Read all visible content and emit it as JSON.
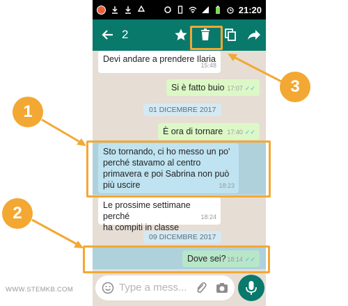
{
  "status_bar": {
    "time": "21:20",
    "icons": [
      "notification-badge",
      "download-icon",
      "download-icon",
      "recycle-icon",
      "sync-icon",
      "vibrate-icon",
      "wifi-icon",
      "signal-icon",
      "battery-icon",
      "alarm-icon"
    ]
  },
  "action_bar": {
    "selected_count": "2",
    "icons": [
      "back-arrow-icon",
      "star-icon",
      "delete-icon",
      "copy-icon",
      "forward-icon"
    ]
  },
  "messages": [
    {
      "text": "Devi andare a prendere Ilaria",
      "time": "15:48",
      "direction": "in"
    },
    {
      "text": "Si è fatto buio",
      "time": "17:07",
      "direction": "out"
    },
    {
      "date": "01 DICEMBRE 2017"
    },
    {
      "text": "È ora di tornare",
      "time": "17:40",
      "direction": "out"
    },
    {
      "lines": [
        "Sto tornando, ci ho messo un po'",
        "perché stavamo al centro",
        "primavera e poi Sabrina non può",
        "più uscire"
      ],
      "time": "18:23",
      "direction": "in",
      "selected": true
    },
    {
      "lines": [
        "Le prossime settimane perché",
        "ha compiti in classe"
      ],
      "time": "18:24",
      "direction": "in"
    },
    {
      "date": "09 DICEMBRE 2017"
    },
    {
      "text": "Dove sei?",
      "time": "18:14",
      "direction": "out",
      "selected": true
    }
  ],
  "input_bar": {
    "placeholder": "Type a mess...",
    "icons": [
      "emoji-icon",
      "attach-icon",
      "camera-icon",
      "mic-icon"
    ]
  },
  "annotations": {
    "labels": [
      "1",
      "2",
      "3"
    ],
    "color": "#f3a833"
  },
  "watermark": "WWW.STEMKB.COM",
  "colors": {
    "header": "#09796c",
    "outgoing_bubble": "#dcf8c6",
    "selection_highlight": "#80c7e2",
    "annotation": "#f3a833"
  }
}
